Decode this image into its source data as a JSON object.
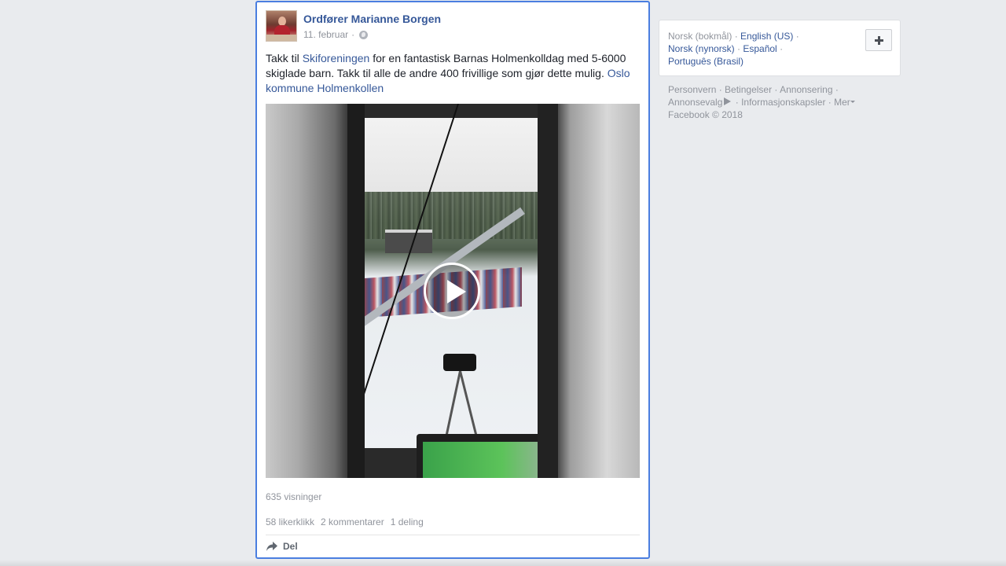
{
  "post": {
    "author": "Ordfører Marianne Borgen",
    "date": "11. februar",
    "date_separator": "·",
    "text": {
      "part1": "Takk til ",
      "link1": "Skiforeningen",
      "part2": " for en fantastisk Barnas Holmenkolldag med 5-6000 skiglade barn. Takk til alle de andre 400 frivillige som gjør dette mulig. ",
      "link2": "Oslo kommune Holmenkollen"
    },
    "views": "635 visninger",
    "likes": "58 likerklikk",
    "comments": "2 kommentarer",
    "shares": "1 deling",
    "share_label": "Del",
    "icons": {
      "privacy": "globe-icon",
      "play": "play-icon",
      "share": "share-arrow-icon"
    }
  },
  "languages": {
    "current": "Norsk (bokmål)",
    "others": [
      "English (US)",
      "Norsk (nynorsk)",
      "Español",
      "Português (Brasil)"
    ],
    "add_icon": "plus-icon"
  },
  "footer": {
    "links": [
      "Personvern",
      "Betingelser",
      "Annonsering",
      "Annonsevalg",
      "Informasjonskapsler",
      "Mer"
    ],
    "copyright": "Facebook © 2018"
  },
  "colors": {
    "link": "#365899",
    "muted": "#90949c",
    "background": "#e9ebee",
    "focus_border": "#4a7ee0"
  }
}
